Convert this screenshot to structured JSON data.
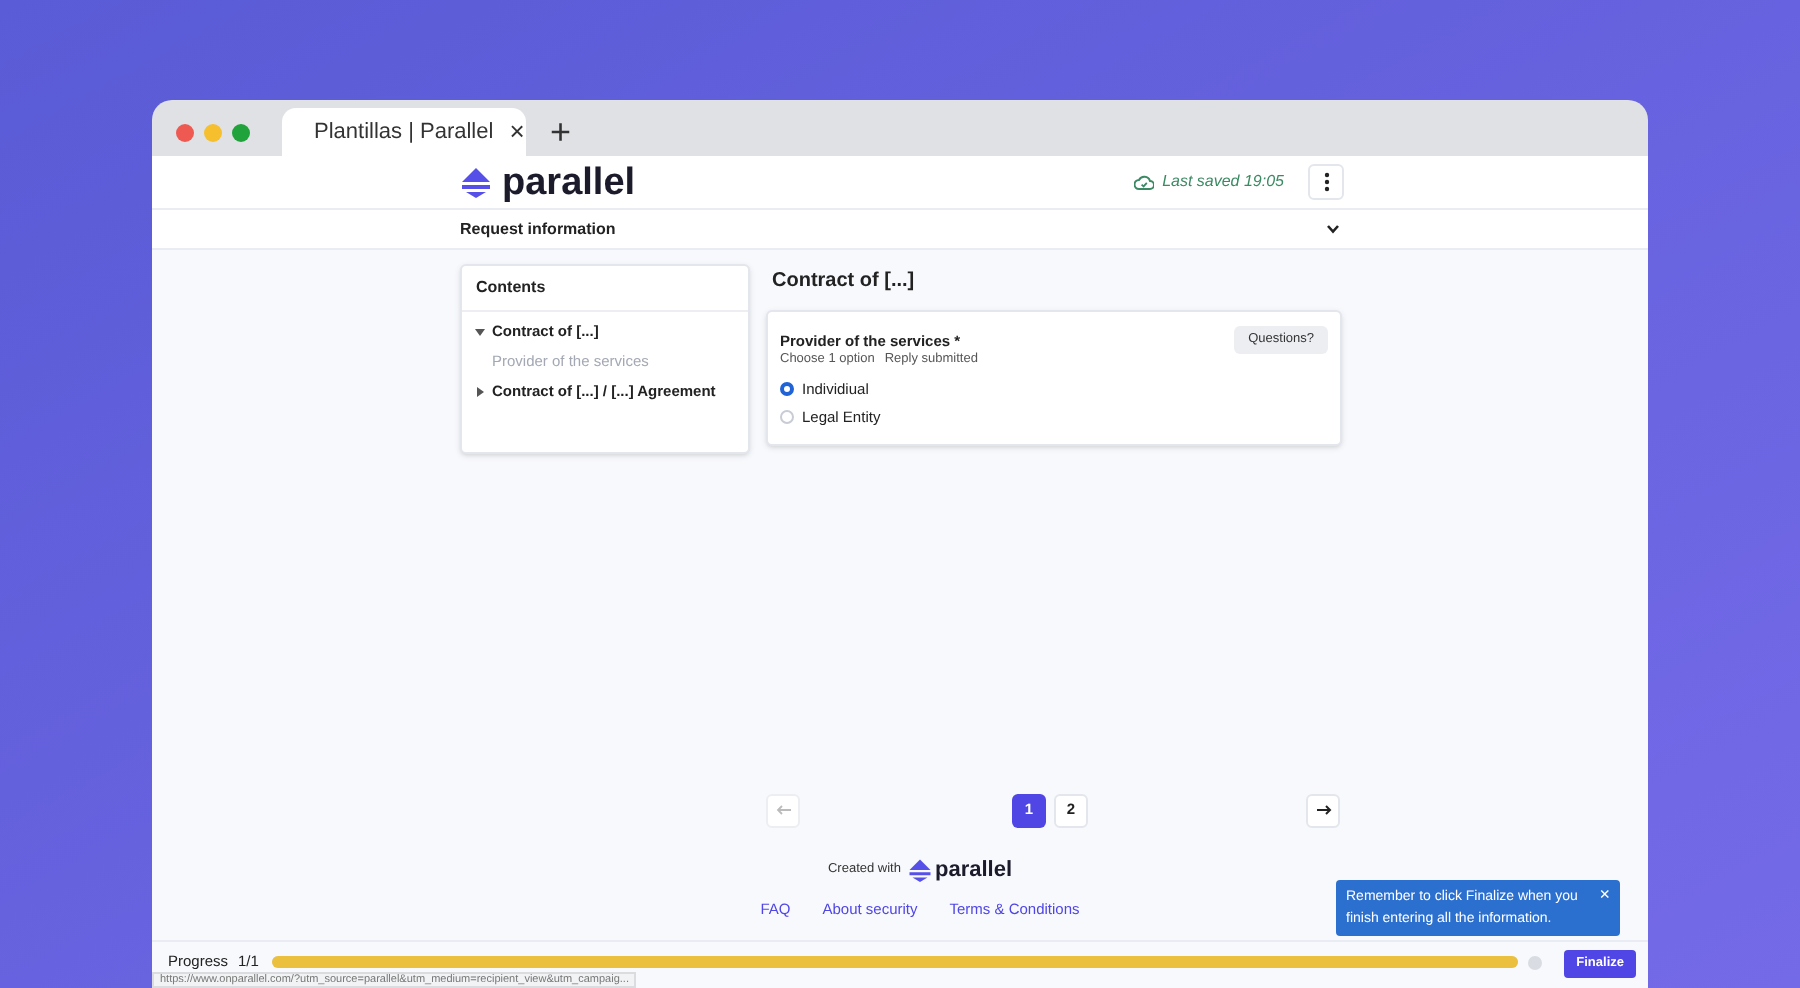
{
  "browser": {
    "tab_title": "Plantillas | Parallel",
    "new_tab": "+",
    "close": "×"
  },
  "header": {
    "logo": "parallel",
    "saved": "Last saved 19:05"
  },
  "request_bar": {
    "label": "Request information",
    "expanded": false
  },
  "contents": {
    "title": "Contents",
    "items": [
      {
        "label": "Contract of [...]",
        "expanded": true,
        "children": [
          {
            "label": "Provider of the services"
          }
        ]
      },
      {
        "label": "Contract of [...] / [...] Agreement",
        "expanded": false
      }
    ]
  },
  "page_title": "Contract of [...]",
  "question": {
    "title": "Provider of the services *",
    "hint": "Choose 1 option",
    "status": "Reply submitted",
    "help_button": "Questions?",
    "options": [
      {
        "label": "Individiual",
        "selected": true
      },
      {
        "label": "Legal Entity",
        "selected": false
      }
    ]
  },
  "pagination": {
    "pages": [
      {
        "label": "1",
        "selected": true
      },
      {
        "label": "2",
        "selected": false
      }
    ]
  },
  "footer": {
    "created_with": "Created with",
    "logo": "parallel",
    "links": [
      "FAQ",
      "About security",
      "Terms & Conditions"
    ]
  },
  "progress": {
    "label": "Progress",
    "count": "1/1",
    "level": 1,
    "button": "Finalize"
  },
  "tooltip": {
    "text": "Remember to click Finalize when you finish entering all the information.",
    "close": "×"
  },
  "status_url": "https://www.onparallel.com/?utm_source=parallel&utm_medium=recipient_view&utm_campaig..."
}
